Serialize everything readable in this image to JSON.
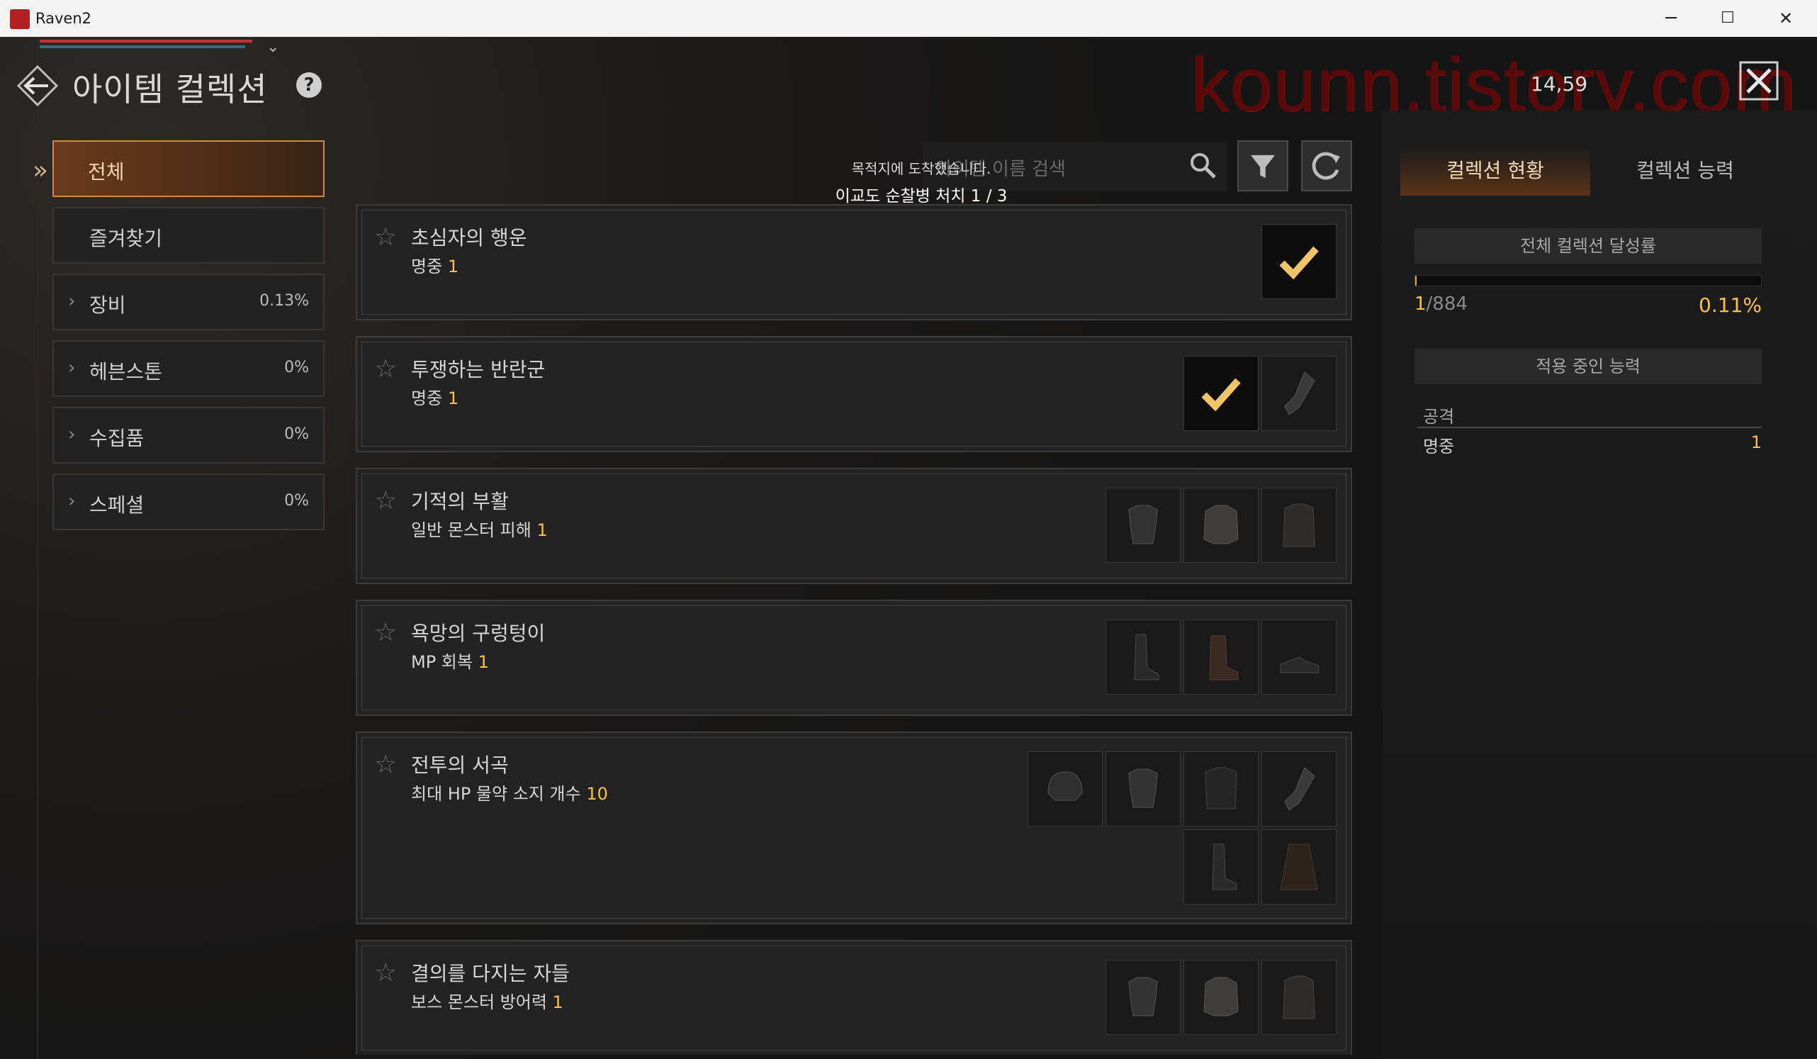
{
  "window": {
    "title": "Raven2",
    "minimize": "─",
    "maximize": "☐",
    "close": "✕"
  },
  "header": {
    "title": "아이템 컬렉션",
    "help": "?",
    "currency": "14,59",
    "watermark": "kounn.tistory.com"
  },
  "nav": {
    "items": [
      {
        "label": "전체",
        "pct": "",
        "active": true
      },
      {
        "label": "즐겨찾기",
        "pct": ""
      },
      {
        "label": "장비",
        "pct": "0.13%"
      },
      {
        "label": "헤븐스톤",
        "pct": "0%"
      },
      {
        "label": "수집품",
        "pct": "0%"
      },
      {
        "label": "스페셜",
        "pct": "0%"
      }
    ]
  },
  "search": {
    "placeholder": "아이템 이름 검색"
  },
  "toast": {
    "line1": "목적지에 도착했습니다.",
    "line2": "이교도 순찰병 처치 1 / 3"
  },
  "collections": [
    {
      "name": "초심자의 행운",
      "stat": "명중",
      "value": "1",
      "slots": [
        "check"
      ]
    },
    {
      "name": "투쟁하는 반란군",
      "stat": "명중",
      "value": "1",
      "slots": [
        "check",
        "gauntlet"
      ]
    },
    {
      "name": "기적의 부활",
      "stat": "일반 몬스터 피해",
      "value": "1",
      "slots": [
        "armor",
        "jacket",
        "coat"
      ]
    },
    {
      "name": "욕망의 구렁텅이",
      "stat": "MP 회복",
      "value": "1",
      "slots": [
        "boots",
        "boots-brown",
        "shoes"
      ]
    },
    {
      "name": "전투의 서곡",
      "stat": "최대 HP 물약 소지 개수",
      "value": "10",
      "slots": [
        "helmet",
        "armor",
        "armor-dark",
        "gauntlet",
        "boots",
        "cloak"
      ]
    },
    {
      "name": "결의를 다지는 자들",
      "stat": "보스 몬스터 방어력",
      "value": "1",
      "slots": [
        "armor",
        "jacket",
        "coat"
      ]
    }
  ],
  "right": {
    "tabs": [
      "컬렉션 현황",
      "컬렉션 능력"
    ],
    "overall_label": "전체 컬렉션 달성률",
    "count_current": "1",
    "count_total": "/884",
    "percent": "0.11%",
    "progress_fraction": 0.0011,
    "applied_label": "적용 중인 능력",
    "ability_category": "공격",
    "ability_name": "명중",
    "ability_value": "1"
  },
  "colors": {
    "accent": "#ffc14a",
    "active_tab": "#c98a4a",
    "watermark": "#5a0a0a"
  }
}
